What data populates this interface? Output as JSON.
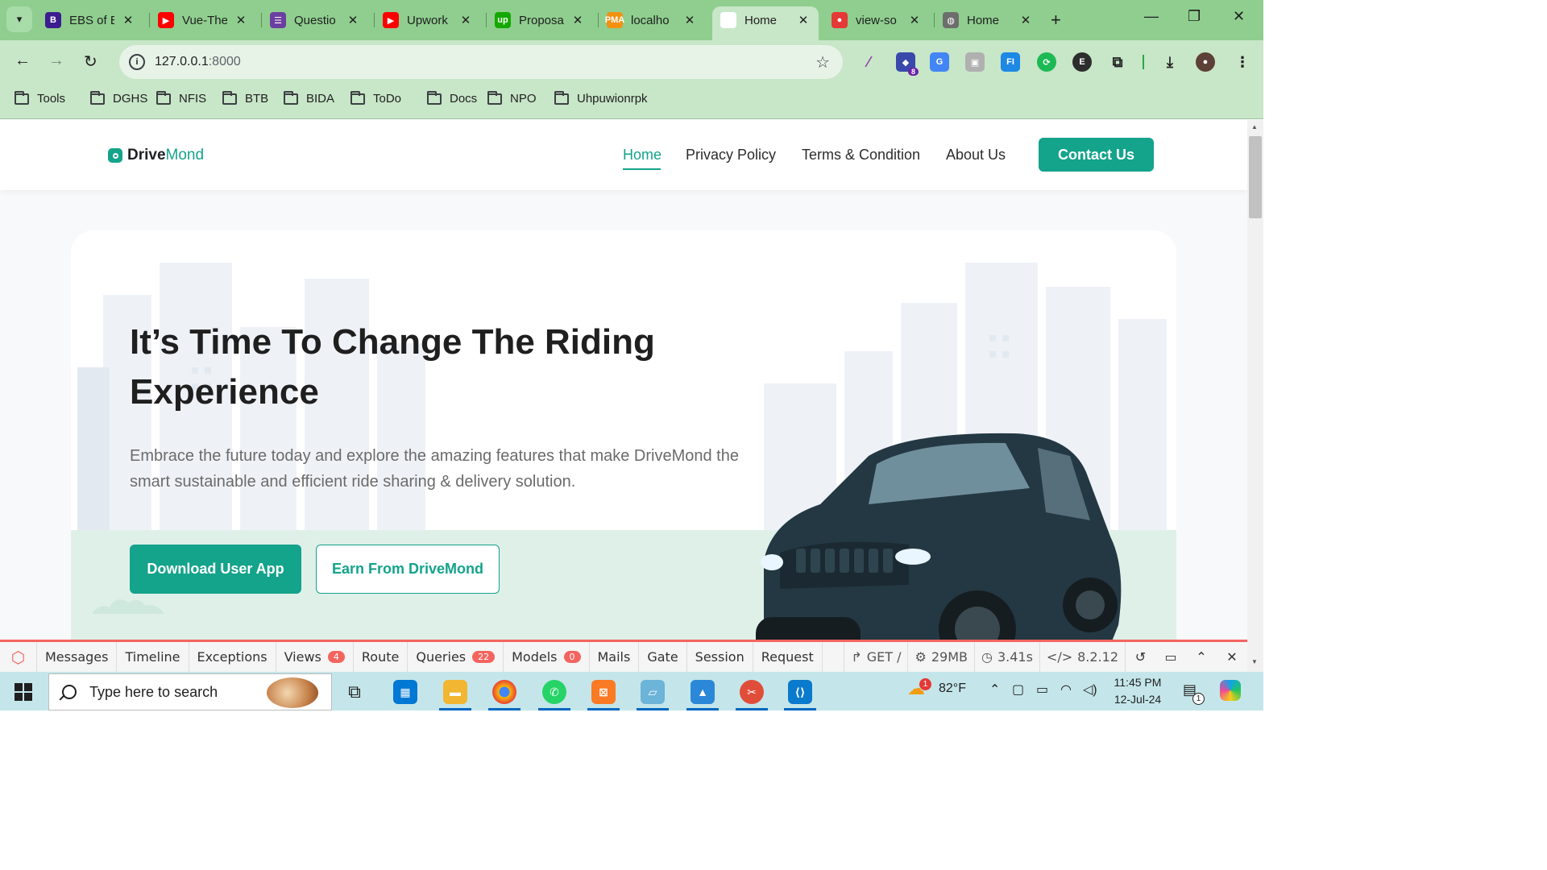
{
  "browser": {
    "tabs": [
      {
        "title": "EBS of E",
        "favicon": "bootstrap-icon",
        "color": "#3b1d8f",
        "glyph": "B"
      },
      {
        "title": "Vue-The",
        "favicon": "youtube-icon",
        "color": "#ff0000",
        "glyph": "▶"
      },
      {
        "title": "Questio",
        "favicon": "forms-icon",
        "color": "#6b3fa0",
        "glyph": "☰"
      },
      {
        "title": "Upwork",
        "favicon": "youtube-icon",
        "color": "#ff0000",
        "glyph": "▶"
      },
      {
        "title": "Proposa",
        "favicon": "upwork-icon",
        "color": "#14a800",
        "glyph": "up"
      },
      {
        "title": "localho",
        "favicon": "phpmyadmin-icon",
        "color": "#f29111",
        "glyph": "PMA"
      },
      {
        "title": "Home",
        "favicon": "page-icon",
        "color": "#ffffff",
        "glyph": ""
      },
      {
        "title": "view-so",
        "favicon": "chrome-red-icon",
        "color": "#e53935",
        "glyph": "●"
      },
      {
        "title": "Home",
        "favicon": "globe-icon",
        "color": "#6d6d6d",
        "glyph": "◍"
      }
    ],
    "active_tab": 6,
    "url_host": "127.0.0.1",
    "url_port": ":8000",
    "extension_badge": "8",
    "bookmarks": [
      "Tools",
      "DGHS",
      "NFIS",
      "BTB",
      "BIDA",
      "ToDo",
      "Docs",
      "NPO",
      "Uhpuwionrpk"
    ]
  },
  "site": {
    "logo_drive": "Drive",
    "logo_mond": "Mond",
    "nav": [
      "Home",
      "Privacy Policy",
      "Terms & Condition",
      "About Us"
    ],
    "contact": "Contact Us",
    "hero_title": "It’s Time To Change The Riding Experience",
    "hero_subtitle": "Embrace the future today and explore the amazing features that make DriveMond the smart sustainable and efficient ride sharing & delivery solution.",
    "btn_primary": "Download User App",
    "btn_secondary": "Earn From DriveMond",
    "accent": "#14a38b"
  },
  "debugbar": {
    "tabs": [
      {
        "label": "Messages",
        "badge": ""
      },
      {
        "label": "Timeline",
        "badge": ""
      },
      {
        "label": "Exceptions",
        "badge": ""
      },
      {
        "label": "Views",
        "badge": "4"
      },
      {
        "label": "Route",
        "badge": ""
      },
      {
        "label": "Queries",
        "badge": "22"
      },
      {
        "label": "Models",
        "badge": "0"
      },
      {
        "label": "Mails",
        "badge": ""
      },
      {
        "label": "Gate",
        "badge": ""
      },
      {
        "label": "Session",
        "badge": ""
      },
      {
        "label": "Request",
        "badge": ""
      }
    ],
    "method": "GET /",
    "memory": "29MB",
    "time": "3.41s",
    "php": "8.2.12"
  },
  "taskbar": {
    "search_placeholder": "Type here to search",
    "weather_temp": "82°F",
    "weather_badge": "1",
    "time": "11:45 PM",
    "date": "12-Jul-24",
    "notification_count": "1"
  }
}
